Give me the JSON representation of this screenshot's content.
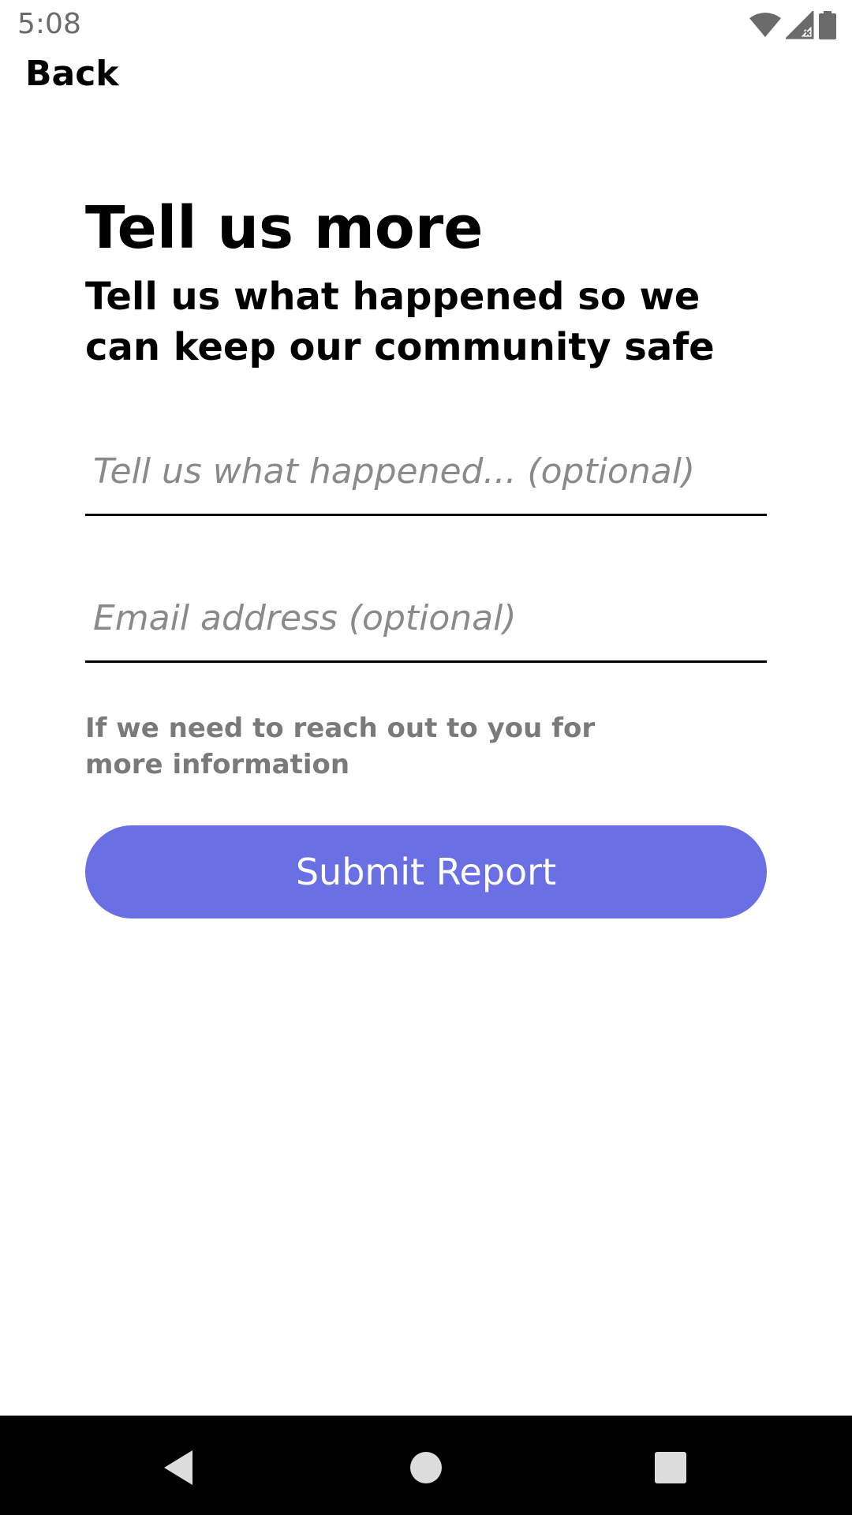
{
  "status_bar": {
    "time": "5:08",
    "icons": [
      "wifi-icon",
      "cell-signal-icon",
      "battery-icon"
    ]
  },
  "header": {
    "back_label": "Back"
  },
  "main": {
    "title": "Tell us more",
    "subtitle": "Tell us what happened so we can keep our community safe",
    "description_field": {
      "value": "",
      "placeholder": "Tell us what happened... (optional)"
    },
    "email_field": {
      "value": "",
      "placeholder": "Email address (optional)"
    },
    "helper_text": "If we need to reach out to you for more information",
    "submit_label": "Submit Report"
  },
  "nav_bar": {
    "icons": [
      "nav-back-icon",
      "nav-home-icon",
      "nav-recents-icon"
    ]
  },
  "colors": {
    "accent": "#6a6fe3",
    "helper_text": "#7a7a7a",
    "placeholder": "#8a8a8a",
    "nav_bar": "#000000"
  }
}
